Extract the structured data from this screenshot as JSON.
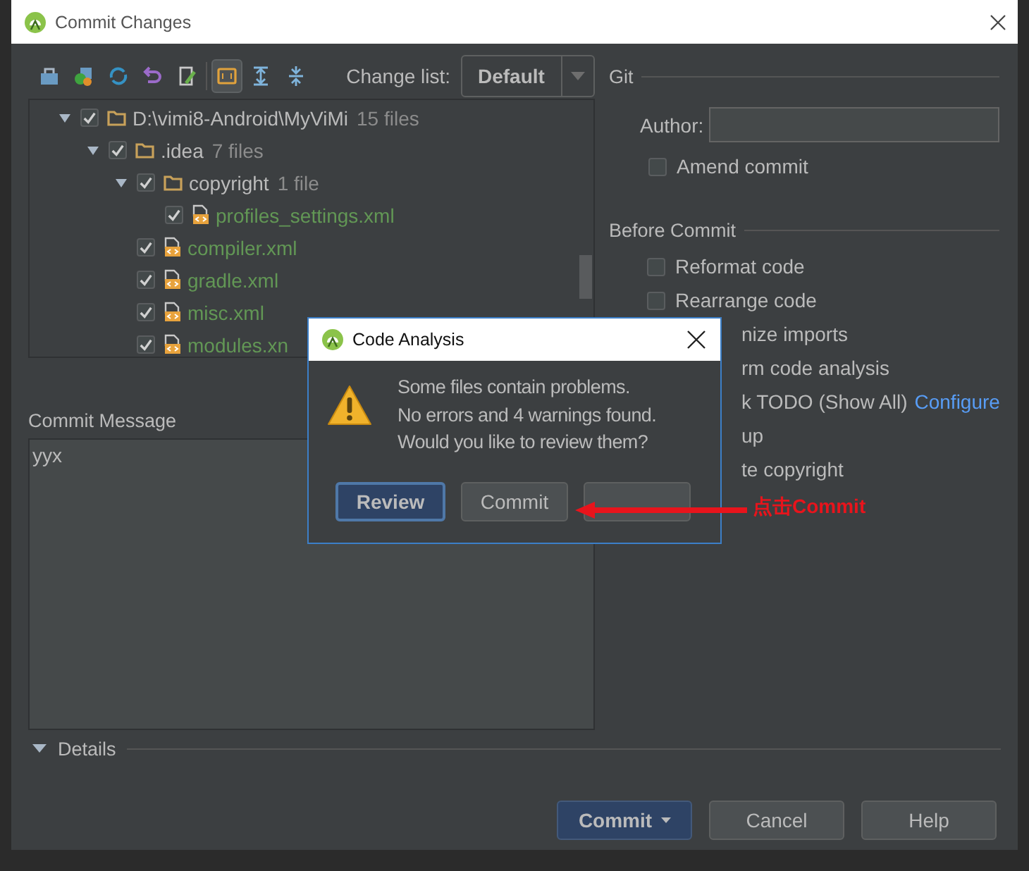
{
  "window": {
    "title": "Commit Changes"
  },
  "toolbar": {
    "buttons": [
      {
        "selected": false
      },
      {
        "selected": false
      },
      {
        "selected": false
      },
      {
        "selected": false
      },
      {
        "selected": false
      },
      {
        "selected": true
      },
      {
        "selected": false
      },
      {
        "selected": false
      }
    ]
  },
  "change_list": {
    "label": "Change list:",
    "value": "Default"
  },
  "tree": [
    {
      "kind": "folder",
      "name": "D:\\vimi8-Android\\MyViMi",
      "count": "15 files",
      "checked": true,
      "expanded": true,
      "children": [
        {
          "kind": "folder",
          "name": ".idea",
          "count": "7 files",
          "checked": true,
          "expanded": true,
          "children": [
            {
              "kind": "folder",
              "name": "copyright",
              "count": "1 file",
              "checked": true,
              "expanded": true,
              "children": [
                {
                  "kind": "file",
                  "name": "profiles_settings.xml",
                  "checked": true
                }
              ]
            },
            {
              "kind": "file",
              "name": "compiler.xml",
              "checked": true
            },
            {
              "kind": "file",
              "name": "gradle.xml",
              "checked": true
            },
            {
              "kind": "file",
              "name": "misc.xml",
              "checked": true
            },
            {
              "kind": "file",
              "name": "modules.xn",
              "checked": true
            }
          ]
        }
      ]
    }
  ],
  "commit_message": {
    "label": "Commit Message",
    "value": "yyx"
  },
  "details": {
    "label": "Details"
  },
  "git": {
    "title": "Git",
    "author_label": "Author:",
    "amend": {
      "label": "Amend commit",
      "checked": false
    }
  },
  "before_commit": {
    "title": "Before Commit",
    "options": [
      {
        "kind": "checkbox",
        "label": "Reformat code",
        "checked": false
      },
      {
        "kind": "checkbox",
        "label": "Rearrange code",
        "checked": false
      },
      {
        "kind": "covered",
        "label": "nize imports"
      },
      {
        "kind": "covered",
        "label": "rm code analysis"
      },
      {
        "kind": "covered",
        "label": "k TODO (Show All)",
        "link": "Configure"
      },
      {
        "kind": "covered",
        "label": "up"
      },
      {
        "kind": "covered",
        "label": "te copyright"
      }
    ]
  },
  "buttons": [
    {
      "kind": "primary",
      "label": "Commit",
      "menu": true
    },
    {
      "kind": "normal",
      "label": "Cancel"
    },
    {
      "kind": "normal",
      "label": "Help"
    }
  ],
  "dialog": {
    "title": "Code Analysis",
    "message": [
      "Some files contain problems.",
      "No errors and 4 warnings found.",
      "Would you like to review them?"
    ],
    "buttons": [
      {
        "kind": "default",
        "label": "Review"
      },
      {
        "kind": "normal",
        "label": "Commit"
      },
      {
        "kind": "covered"
      }
    ]
  },
  "annotation": {
    "text": "点击Commit"
  }
}
